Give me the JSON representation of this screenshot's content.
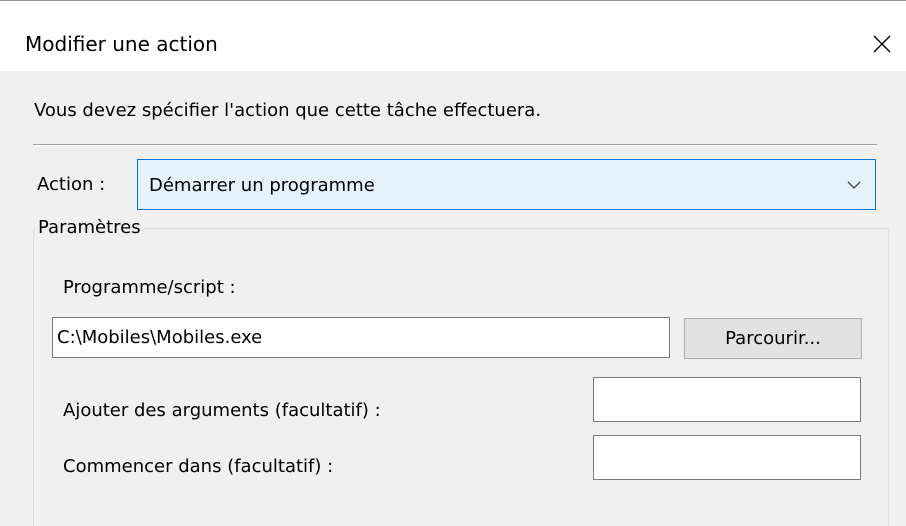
{
  "window": {
    "title": "Modifier une action",
    "close_icon": "close-icon"
  },
  "dialog": {
    "instruction": "Vous devez spécifier l'action que cette tâche effectuera.",
    "action": {
      "label": "Action :",
      "selected": "Démarrer un programme",
      "dropdown_icon": "chevron-down-icon"
    },
    "parameters": {
      "legend": "Paramètres",
      "program": {
        "label": "Programme/script :",
        "value": "C:\\Mobiles\\Mobiles.exe",
        "browse_label": "Parcourir..."
      },
      "arguments": {
        "label": "Ajouter des arguments (facultatif) :",
        "value": ""
      },
      "start_in": {
        "label": "Commencer dans (facultatif) :",
        "value": ""
      }
    }
  },
  "colors": {
    "client_background": "#f0f0f0",
    "focus_border": "#0078d7",
    "focus_fill": "#e5f1fb",
    "button_fill": "#e1e1e1"
  }
}
